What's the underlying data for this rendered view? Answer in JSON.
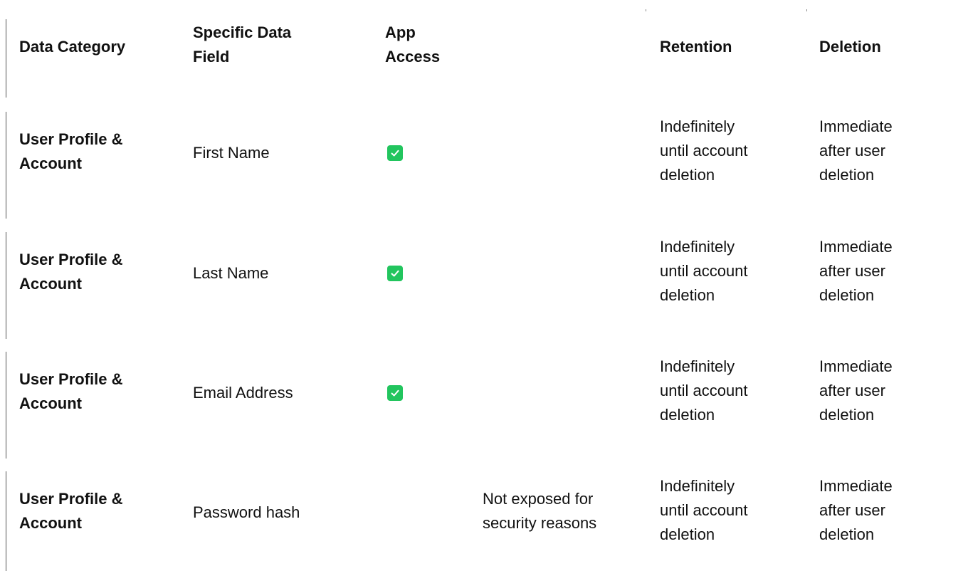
{
  "table": {
    "headers": {
      "category": "Data Category",
      "field_line1": "Specific Data",
      "field_line2": "Field",
      "access_line1": "App",
      "access_line2": "Access",
      "notes": "",
      "retention": "Retention",
      "deletion": "Deletion"
    },
    "rows": [
      {
        "category_line1": "User Profile &",
        "category_line2": "Account",
        "field": "First Name",
        "app_access": true,
        "access_icon": "check-icon",
        "notes_line1": "",
        "notes_line2": "",
        "retention_line1": "Indefinitely",
        "retention_line2": "until account",
        "retention_line3": "deletion",
        "deletion_line1": "Immediate",
        "deletion_line2": "after user",
        "deletion_line3": "deletion"
      },
      {
        "category_line1": "User Profile &",
        "category_line2": "Account",
        "field": "Last Name",
        "app_access": true,
        "access_icon": "check-icon",
        "notes_line1": "",
        "notes_line2": "",
        "retention_line1": "Indefinitely",
        "retention_line2": "until account",
        "retention_line3": "deletion",
        "deletion_line1": "Immediate",
        "deletion_line2": "after user",
        "deletion_line3": "deletion"
      },
      {
        "category_line1": "User Profile &",
        "category_line2": "Account",
        "field": "Email Address",
        "app_access": true,
        "access_icon": "check-icon",
        "notes_line1": "",
        "notes_line2": "",
        "retention_line1": "Indefinitely",
        "retention_line2": "until account",
        "retention_line3": "deletion",
        "deletion_line1": "Immediate",
        "deletion_line2": "after user",
        "deletion_line3": "deletion"
      },
      {
        "category_line1": "User Profile &",
        "category_line2": "Account",
        "field": "Password hash",
        "app_access": false,
        "access_icon": "",
        "notes_line1": "Not exposed for",
        "notes_line2": "security reasons",
        "retention_line1": "Indefinitely",
        "retention_line2": "until account",
        "retention_line3": "deletion",
        "deletion_line1": "Immediate",
        "deletion_line2": "after user",
        "deletion_line3": "deletion"
      }
    ]
  },
  "colors": {
    "check_green": "#22c55e",
    "text": "#111111"
  }
}
